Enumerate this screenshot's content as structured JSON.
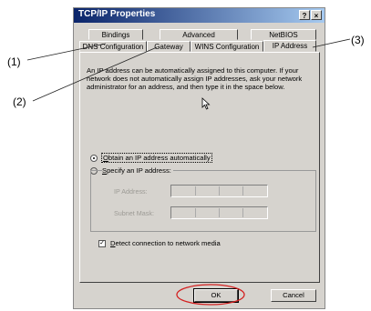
{
  "window": {
    "title": "TCP/IP Properties",
    "help_label": "?",
    "close_label": "×"
  },
  "tabs": {
    "row1": [
      "Bindings",
      "Advanced",
      "NetBIOS"
    ],
    "row2": [
      "DNS Configuration",
      "Gateway",
      "WINS Configuration",
      "IP Address"
    ]
  },
  "description": "An IP address can be automatically assigned to this computer. If your network does not automatically assign IP addresses, ask your network administrator for an address, and then type it in the space below.",
  "options": {
    "obtain_auto": {
      "label_key": "O",
      "label_rest": "btain an IP address automatically",
      "selected": true
    },
    "specify": {
      "label_key": "S",
      "label_rest": "pecify an IP address:",
      "selected": false
    }
  },
  "fields": {
    "ip_address_label": "IP Address:",
    "subnet_mask_label": "Subnet Mask:"
  },
  "detect_media": {
    "label_key": "D",
    "label_rest": "etect connection to network media",
    "checked": true,
    "check_glyph": "✓"
  },
  "buttons": {
    "ok": "OK",
    "cancel": "Cancel"
  },
  "callouts": [
    "(1)",
    "(2)",
    "(3)"
  ],
  "colors": {
    "callout_ellipse": "#d42020",
    "title_bar": "#0a246a"
  }
}
